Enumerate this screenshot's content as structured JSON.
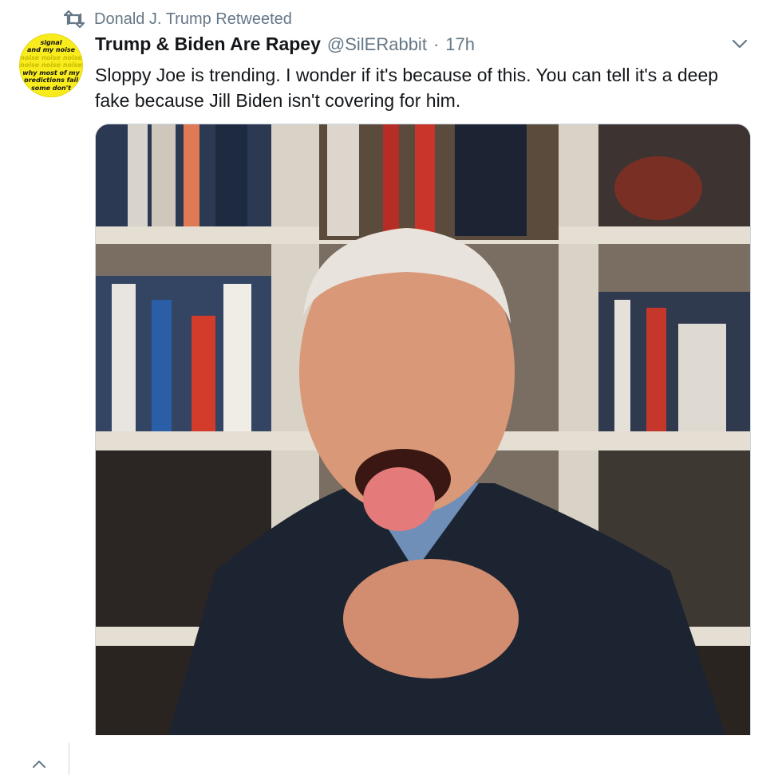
{
  "retweet": {
    "icon": "retweet-icon",
    "text": "Donald J. Trump Retweeted"
  },
  "tweet": {
    "author": {
      "display_name": "Trump & Biden Are Rapey",
      "handle": "@SilERabbit",
      "avatar_lines": [
        "signal",
        "and my noise",
        "noise noise noise",
        "noise noise noise",
        "why most of my",
        "predictions fail",
        "some don't"
      ]
    },
    "separator": "·",
    "time": "17h",
    "text": "Sloppy Joe is trending. I wonder if it's because of this. You can tell it's a deep fake because Jill Biden isn't covering for him.",
    "menu_icon": "chevron-down-icon"
  },
  "colors": {
    "accent": "#1da1f2",
    "secondary_text": "#657786",
    "primary_text": "#14171a",
    "avatar_bg": "#f8ec1f"
  },
  "bottom_bar": {
    "icon": "chevron-up-icon"
  }
}
